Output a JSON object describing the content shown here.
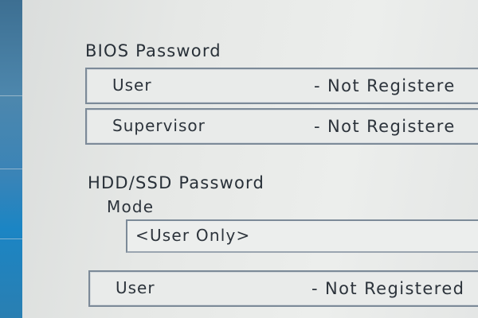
{
  "bios_password": {
    "heading": "BIOS Password",
    "rows": [
      {
        "label": "User",
        "status": "- Not Registere"
      },
      {
        "label": "Supervisor",
        "status": "- Not Registere"
      }
    ]
  },
  "hdd_ssd_password": {
    "heading": "HDD/SSD Password",
    "mode_label": "Mode",
    "mode_value": "<User Only>",
    "rows": [
      {
        "label": "User",
        "status": "- Not Registered"
      }
    ]
  },
  "colors": {
    "accent_bar": "#1b85c4",
    "field_border": "#7c8a98",
    "background": "#e6e8e6"
  }
}
